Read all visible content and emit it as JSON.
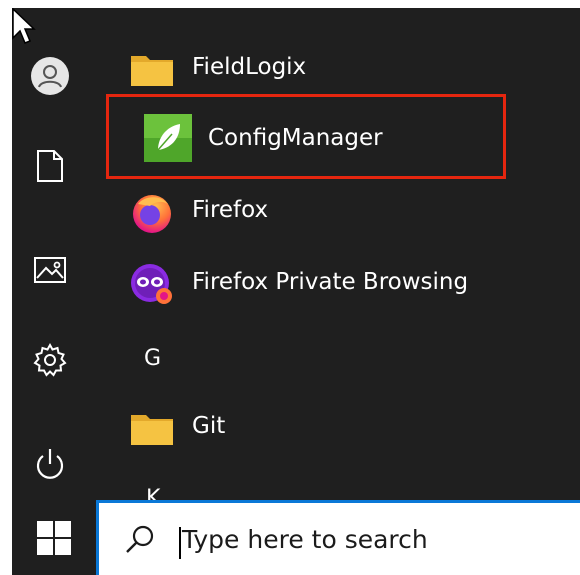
{
  "colors": {
    "menu_bg": "#1f1f1f",
    "highlight_border": "#e5260f",
    "search_border": "#0a78d7",
    "folder": "#f5c342",
    "configmanager_green": "#4fa62a"
  },
  "sidebar": {
    "items": [
      {
        "icon": "user-icon"
      },
      {
        "icon": "document-icon"
      },
      {
        "icon": "pictures-icon"
      },
      {
        "icon": "settings-gear-icon"
      },
      {
        "icon": "power-icon"
      }
    ]
  },
  "apps": [
    {
      "label": "FieldLogix",
      "icon": "folder-icon"
    },
    {
      "label": "ConfigManager",
      "icon": "configmanager-leaf-icon"
    },
    {
      "label": "Firefox",
      "icon": "firefox-icon"
    },
    {
      "label": "Firefox Private Browsing",
      "icon": "firefox-private-icon"
    },
    {
      "letter": "G"
    },
    {
      "label": "Git",
      "icon": "folder-icon"
    },
    {
      "letter": "K"
    }
  ],
  "taskbar": {
    "start_icon": "windows-logo-icon",
    "search": {
      "icon": "search-icon",
      "placeholder": "Type here to search"
    }
  }
}
